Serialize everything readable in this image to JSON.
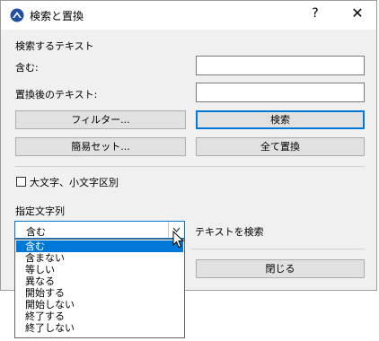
{
  "window": {
    "title": "検索と置換",
    "help": "?",
    "close": "✕"
  },
  "search": {
    "section": "検索するテキスト",
    "contains_label": "含む:",
    "contains_value": "",
    "replace_label": "置換後のテキスト:",
    "replace_value": ""
  },
  "buttons": {
    "filter": "フィルター...",
    "find": "検索",
    "quick_set": "簡易セット...",
    "replace_all": "全て置換",
    "close": "閉じる"
  },
  "options": {
    "match_case": "大文字、小文字区別",
    "match_case_checked": false
  },
  "criteria": {
    "section": "指定文字列",
    "selected": "含む",
    "after_label": "テキストを検索",
    "options": [
      "含む",
      "含まない",
      "等しい",
      "異なる",
      "開始する",
      "開始しない",
      "終了する",
      "終了しない"
    ]
  }
}
